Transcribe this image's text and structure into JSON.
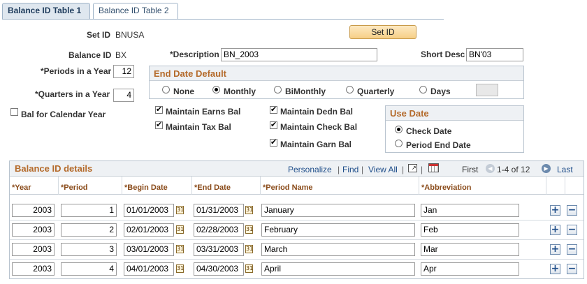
{
  "tabs": [
    {
      "label": "Balance ID Table 1"
    },
    {
      "label": "Balance ID Table 2"
    }
  ],
  "setid": {
    "label": "Set ID",
    "value": "BNUSA",
    "button": "Set ID"
  },
  "balanceid": {
    "label": "Balance ID",
    "value": "BX"
  },
  "description": {
    "label": "*Description",
    "value": "BN_2003"
  },
  "shortdesc": {
    "label": "Short Desc",
    "value": "BN'03"
  },
  "periods": {
    "label": "*Periods in a Year",
    "value": "12"
  },
  "quarters": {
    "label": "*Quarters in a Year",
    "value": "4"
  },
  "calyear": {
    "label": "Bal for Calendar Year",
    "checked": false
  },
  "enddate": {
    "title": "End Date Default",
    "options": [
      "None",
      "Monthly",
      "BiMonthly",
      "Quarterly",
      "Days"
    ],
    "selected": "Monthly",
    "days_value": ""
  },
  "maintain": {
    "earns": "Maintain Earns Bal",
    "tax": "Maintain Tax Bal",
    "dedn": "Maintain Dedn Bal",
    "check": "Maintain Check Bal",
    "garn": "Maintain Garn Bal"
  },
  "usedate": {
    "title": "Use Date",
    "options": [
      "Check Date",
      "Period End Date"
    ],
    "selected": "Check Date"
  },
  "grid": {
    "title": "Balance ID details",
    "toolbar": {
      "personalize": "Personalize",
      "find": "Find",
      "viewall": "View All",
      "first": "First",
      "range": "1-4 of 12",
      "last": "Last"
    },
    "columns": [
      "*Year",
      "*Period",
      "*Begin Date",
      "*End Date",
      "*Period Name",
      "*Abbreviation"
    ],
    "rows": [
      {
        "year": "2003",
        "period": "1",
        "begin": "01/01/2003",
        "end": "01/31/2003",
        "name": "January",
        "abbr": "Jan"
      },
      {
        "year": "2003",
        "period": "2",
        "begin": "02/01/2003",
        "end": "02/28/2003",
        "name": "February",
        "abbr": "Feb"
      },
      {
        "year": "2003",
        "period": "3",
        "begin": "03/01/2003",
        "end": "03/31/2003",
        "name": "March",
        "abbr": "Mar"
      },
      {
        "year": "2003",
        "period": "4",
        "begin": "04/01/2003",
        "end": "04/30/2003",
        "name": "April",
        "abbr": "Apr"
      }
    ]
  }
}
